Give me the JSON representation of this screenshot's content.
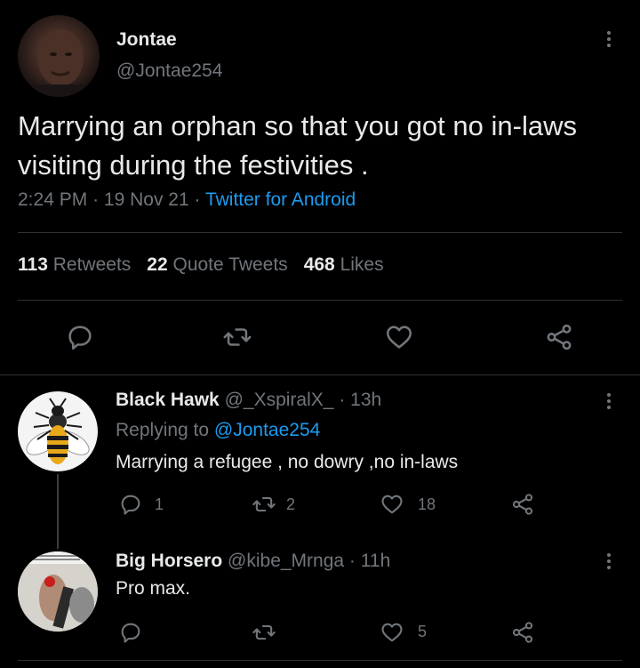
{
  "main_tweet": {
    "author_name": "Jontae",
    "author_handle": "@Jontae254",
    "text_line1": "Marrying an orphan so that you got no in-laws",
    "text_line2": "visiting during the festivities .",
    "time": "2:24 PM",
    "sep1": "·",
    "date": "19 Nov 21",
    "sep2": "·",
    "source": "Twitter for Android",
    "stats": {
      "retweets_count": "113",
      "retweets_label": "Retweets",
      "quotes_count": "22",
      "quotes_label": "Quote Tweets",
      "likes_count": "468",
      "likes_label": "Likes"
    },
    "actions": [
      "reply-icon",
      "retweet-icon",
      "like-icon",
      "share-icon"
    ]
  },
  "replies": [
    {
      "name": "Black Hawk",
      "handle": "@_XspiralX_",
      "sep": "·",
      "time": "13h",
      "replying_prefix": "Replying to",
      "replying_to": "@Jontae254",
      "text": "Marrying a refugee , no dowry ,no in-laws",
      "reply_count": "1",
      "retweet_count": "2",
      "like_count": "18"
    },
    {
      "name": "Big Horsero",
      "handle": "@kibe_Mrnga",
      "sep": "·",
      "time": "11h",
      "text": "Pro max.",
      "reply_count": "",
      "retweet_count": "",
      "like_count": "5"
    }
  ],
  "colors": {
    "background": "#000000",
    "text": "#e7e9ea",
    "muted": "#71767b",
    "link": "#1d9bf0",
    "divider": "#2f3336"
  }
}
